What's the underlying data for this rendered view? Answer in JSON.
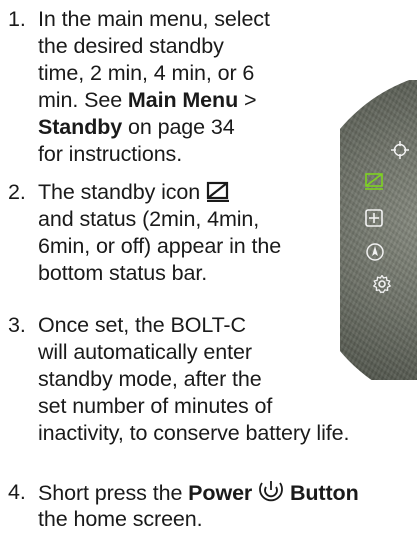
{
  "steps": [
    {
      "number": "1.",
      "lines": [
        "In the main menu, select",
        "the desired standby",
        "time, 2 min, 4 min, or 6",
        "min. See "
      ],
      "link1": "Main Menu",
      "sep": " >",
      "link2": "Standby",
      "after_link2": " on page 34",
      "last_line": "for instructions."
    },
    {
      "number": "2.",
      "line1_before_icon": "The standby icon ",
      "line2": "and status (2min, 4min,",
      "line3": "6min, or off) appear in the",
      "line4": "bottom status bar."
    },
    {
      "number": "3.",
      "lines": [
        "Once set, the BOLT-C",
        "will automatically enter",
        "standby mode, after the",
        "set number of minutes of"
      ],
      "hang_line": "inactivity, to conserve battery life."
    },
    {
      "number": "4.",
      "before_bold": "Short press the ",
      "bold1": "Power",
      "bold2": "Button",
      "line2": "the home screen."
    }
  ],
  "device_icons": [
    "crosshair-icon",
    "standby-icon",
    "plus-box-icon",
    "compass-icon",
    "settings-gear-icon"
  ],
  "colors": {
    "standby_icon_green": "#7ed321",
    "device_icon_white": "#f2f2f2"
  }
}
